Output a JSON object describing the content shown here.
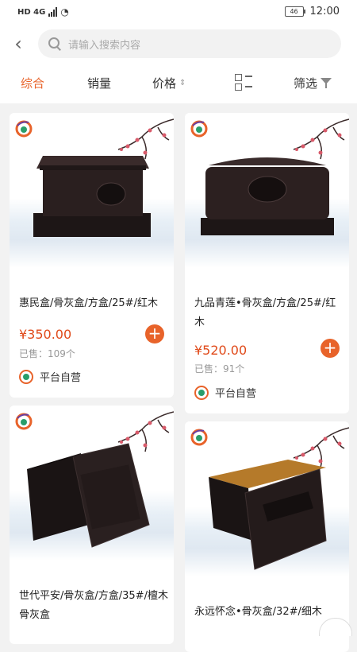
{
  "status": {
    "network": "HD 4G",
    "battery": "46",
    "time": "12:00"
  },
  "search": {
    "placeholder": "请输入搜索内容"
  },
  "sort": {
    "comprehensive": "综合",
    "sales": "销量",
    "price": "价格",
    "filter": "筛选"
  },
  "products": [
    {
      "name": "惠民盒/骨灰盒/方盒/25#/红木",
      "price": "¥350.00",
      "sold": "已售：109个",
      "seller": "平台自营"
    },
    {
      "name": "九品青莲•骨灰盒/方盒/25#/红木",
      "price": "¥520.00",
      "sold": "已售：91个",
      "seller": "平台自营"
    },
    {
      "name": "世代平安/骨灰盒/方盒/35#/檀木骨灰盒"
    },
    {
      "name": "永远怀念•骨灰盒/32#/细木"
    }
  ],
  "colors": {
    "accent": "#e8632a",
    "price": "#e04a1a"
  }
}
